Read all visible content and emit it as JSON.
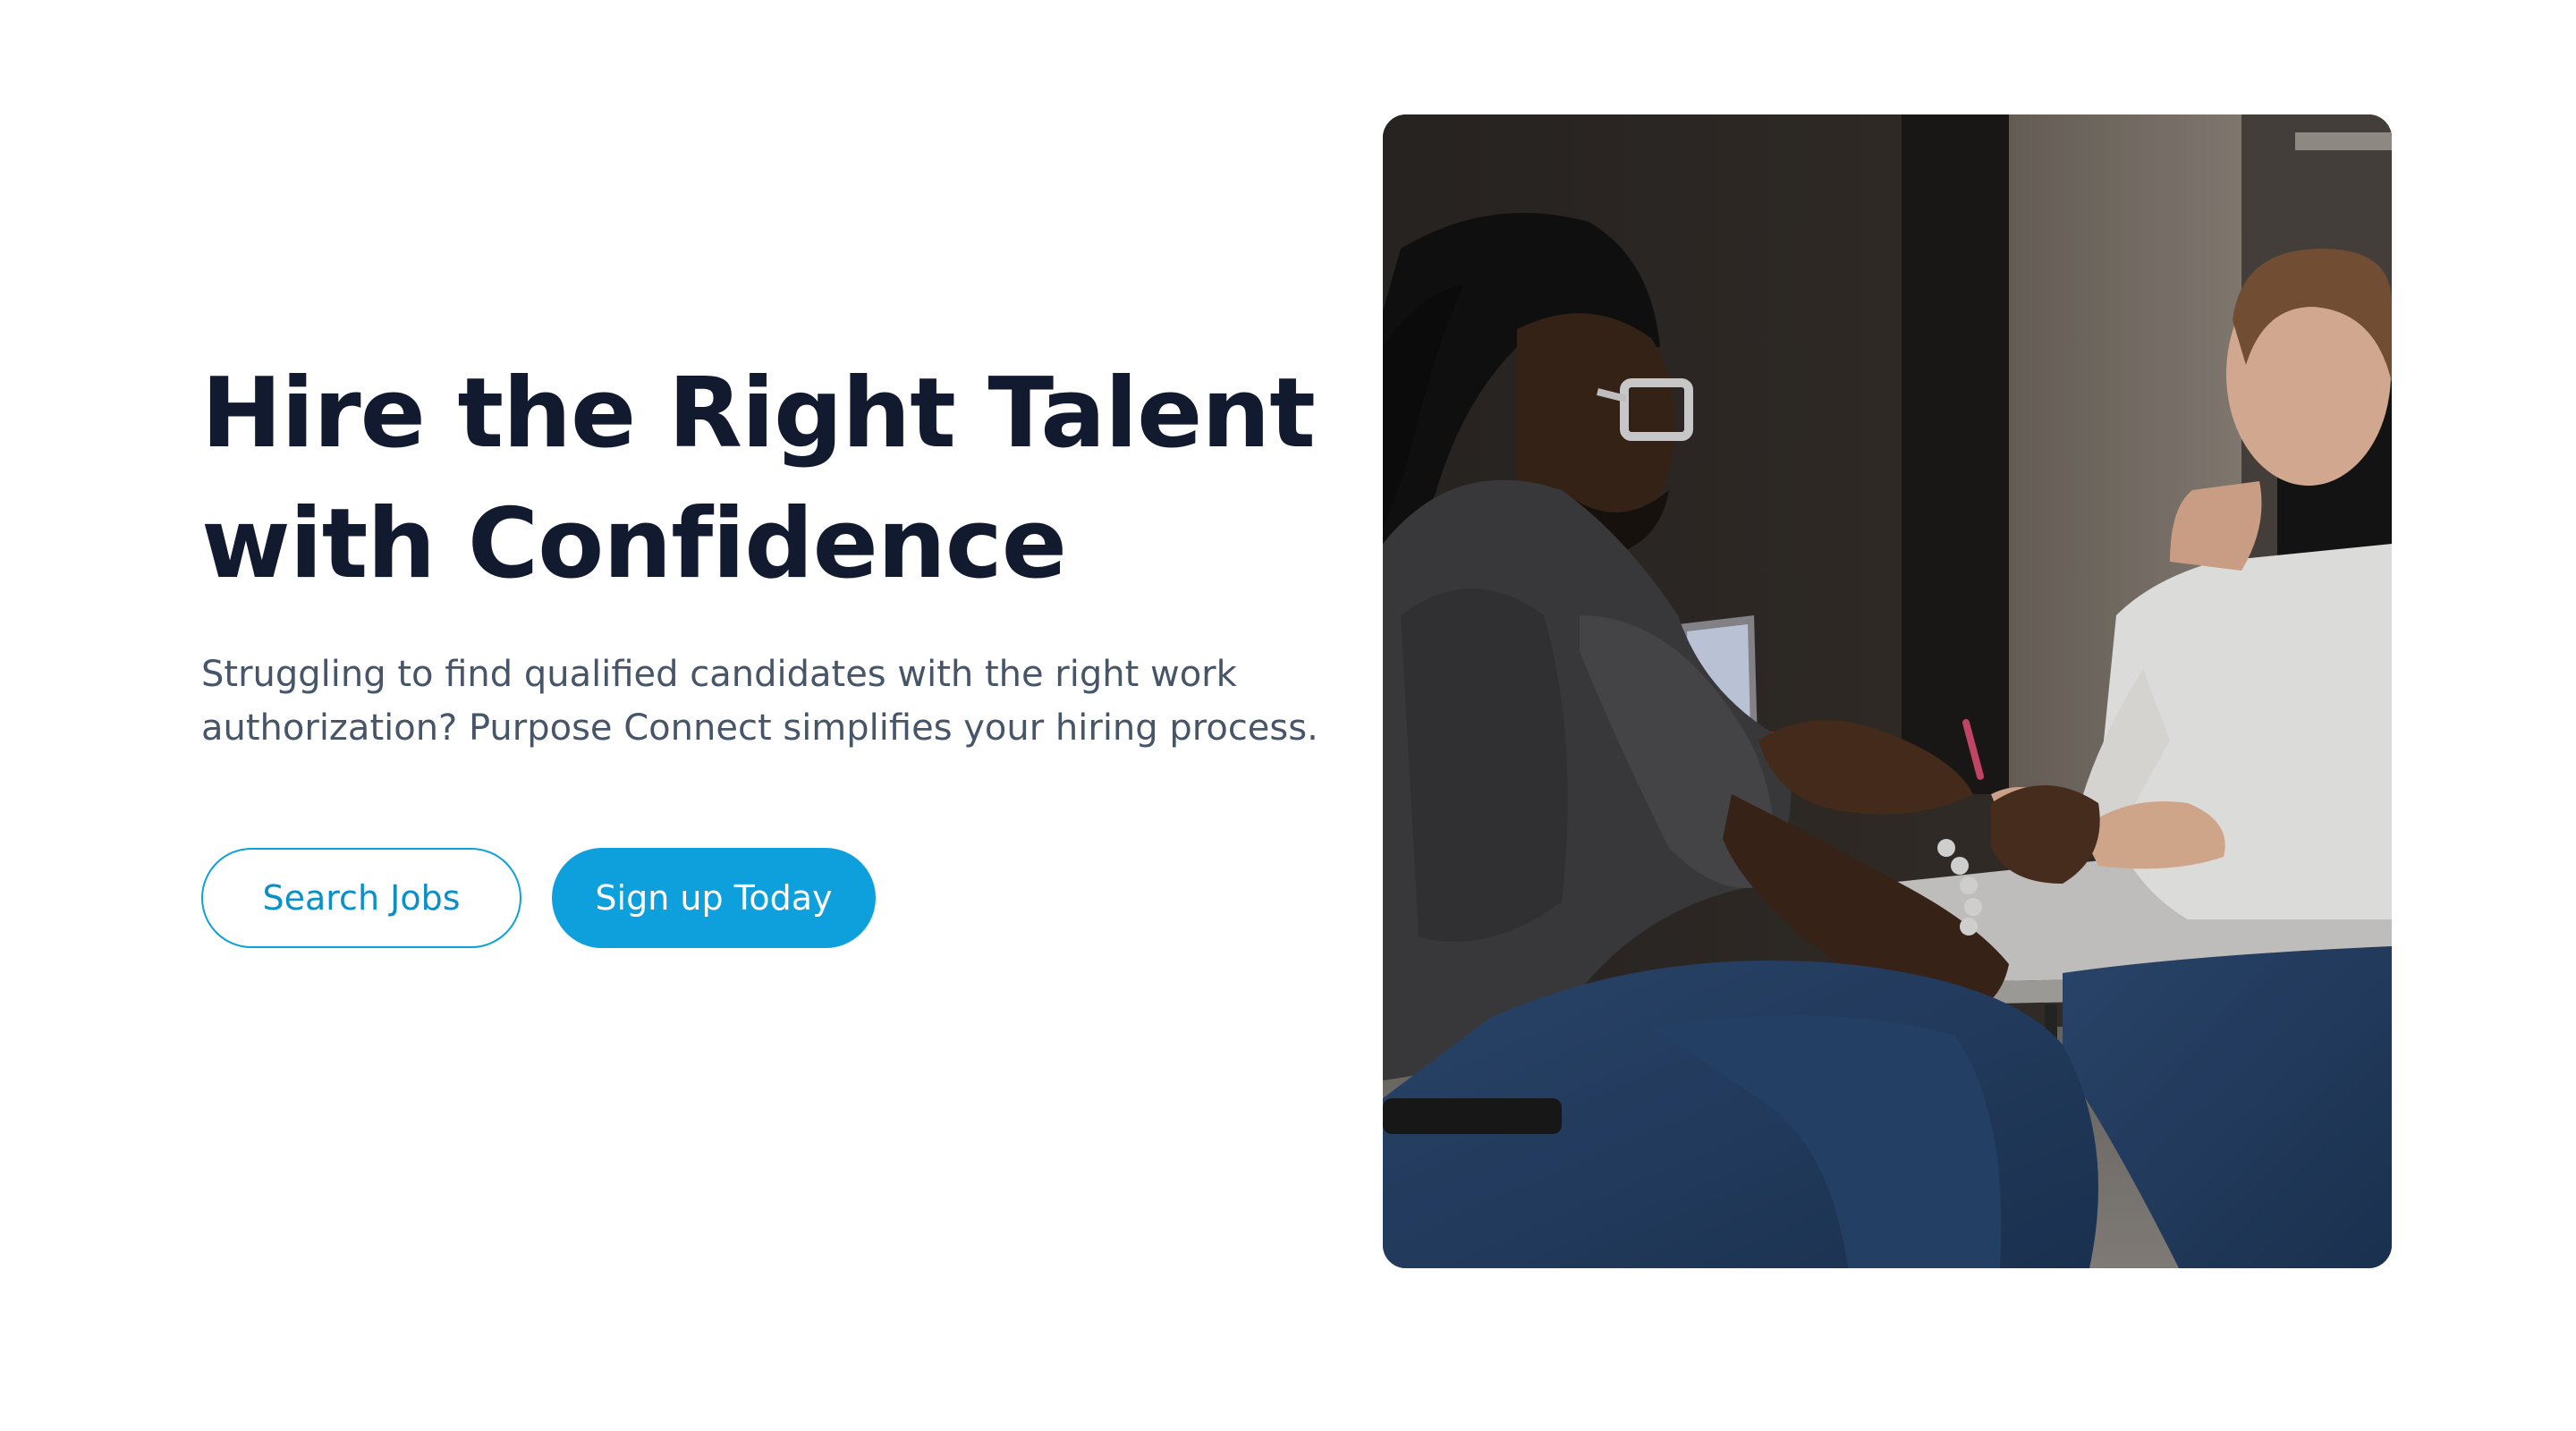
{
  "hero": {
    "headline_line1": "Hire the Right Talent",
    "headline_line2": "with Confidence",
    "subtext_line1": "Struggling to find qualified candidates with the right work",
    "subtext_line2": "authorization? Purpose Connect simplifies your hiring process."
  },
  "buttons": {
    "search_jobs": "Search Jobs",
    "sign_up": "Sign up Today"
  },
  "photo": {
    "alt": "Two people talking across a table during an interview"
  },
  "colors": {
    "accent": "#0ea0dd",
    "heading": "#111a2e",
    "body_text": "#475569",
    "background": "#ffffff"
  }
}
